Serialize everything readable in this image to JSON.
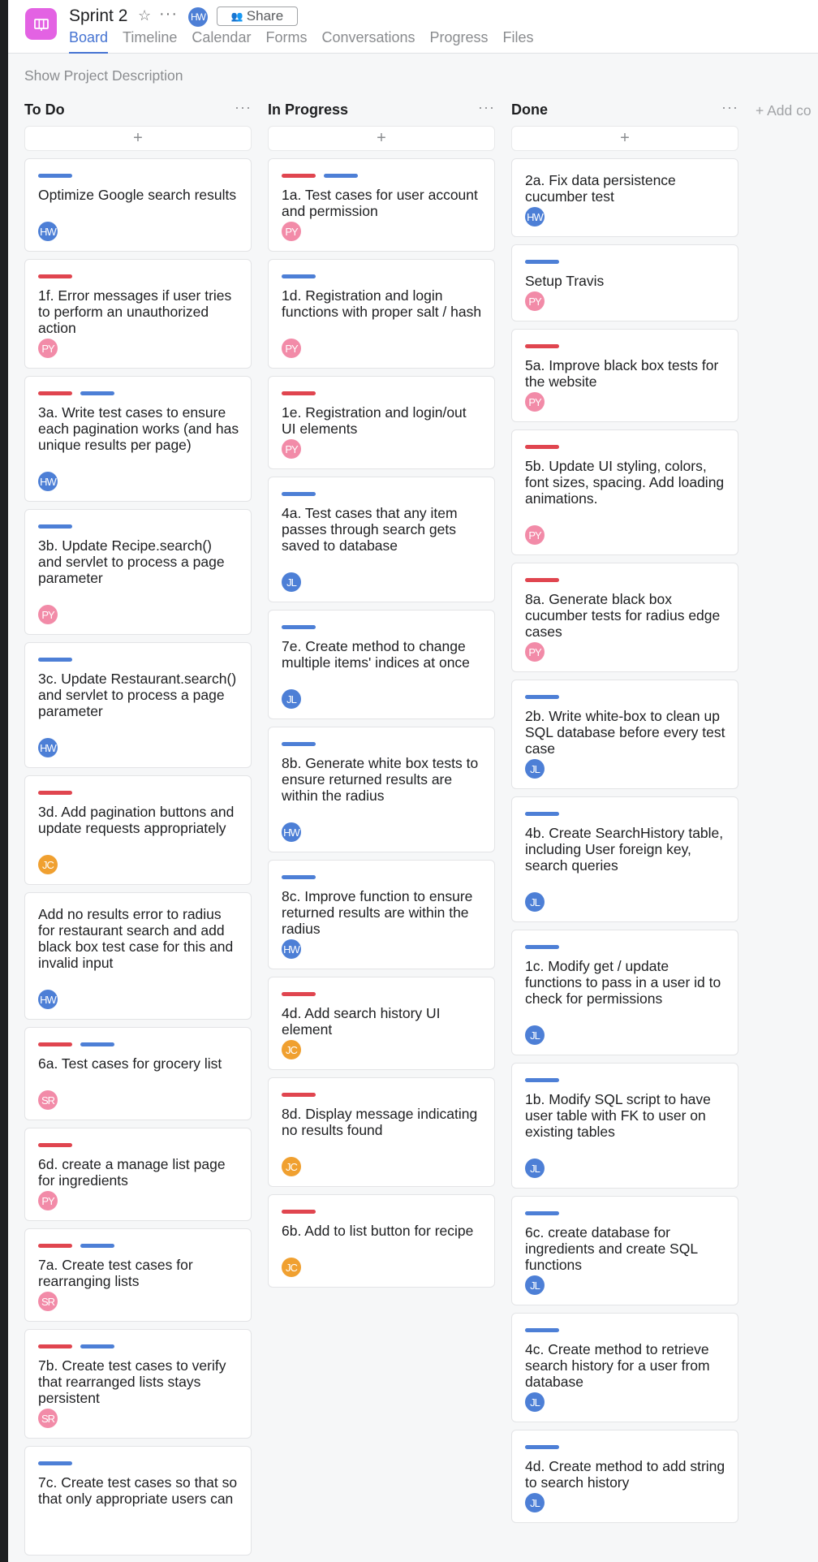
{
  "project": {
    "title": "Sprint 2",
    "header_avatar": "HW",
    "share_label": "Share",
    "icon": "board-icon"
  },
  "tabs": [
    "Board",
    "Timeline",
    "Calendar",
    "Forms",
    "Conversations",
    "Progress",
    "Files"
  ],
  "active_tab": "Board",
  "show_description_label": "Show Project Description",
  "add_column_label": "+ Add co",
  "add_task_label": "+",
  "colors": {
    "accent": "#4573d2",
    "tag_red": "#e0454f",
    "tag_blue": "#4d7fd6",
    "avatar_HW": "#4d7fd6",
    "avatar_JL": "#4d7fd6",
    "avatar_PY": "#f28ba8",
    "avatar_SR": "#f28ba8",
    "avatar_JC": "#f0a030",
    "project_icon": "#e362e3"
  },
  "columns": [
    {
      "title": "To Do",
      "cards": [
        {
          "title": "Optimize Google search results",
          "tags": [
            "blue"
          ],
          "assignee": "HW"
        },
        {
          "title": "1f. Error messages if user tries to perform an unauthorized action",
          "tags": [
            "red"
          ],
          "assignee": "PY"
        },
        {
          "title": "3a. Write test cases to ensure each pagination works (and has unique results per page)",
          "tags": [
            "red",
            "blue"
          ],
          "assignee": "HW"
        },
        {
          "title": "3b. Update Recipe.search() and servlet to process a page parameter",
          "tags": [
            "blue"
          ],
          "assignee": "PY"
        },
        {
          "title": "3c. Update Restaurant.search() and servlet to process a page parameter",
          "tags": [
            "blue"
          ],
          "assignee": "HW"
        },
        {
          "title": "3d. Add pagination buttons and update requests appropriately",
          "tags": [
            "red"
          ],
          "assignee": "JC"
        },
        {
          "title": "Add no results error to radius for restaurant search and add black box test case for this and invalid input",
          "tags": [],
          "assignee": "HW"
        },
        {
          "title": "6a. Test cases for grocery list",
          "tags": [
            "red",
            "blue"
          ],
          "assignee": "SR"
        },
        {
          "title": "6d. create a manage list page for ingredients",
          "tags": [
            "red"
          ],
          "assignee": "PY"
        },
        {
          "title": "7a. Create test cases for rearranging lists",
          "tags": [
            "red",
            "blue"
          ],
          "assignee": "SR"
        },
        {
          "title": "7b. Create test cases to verify that rearranged lists stays persistent",
          "tags": [
            "red",
            "blue"
          ],
          "assignee": "SR"
        },
        {
          "title": "7c. Create test cases so that so that only appropriate users can",
          "tags": [
            "blue"
          ],
          "assignee": ""
        }
      ]
    },
    {
      "title": "In Progress",
      "cards": [
        {
          "title": "1a. Test cases for user account and permission",
          "tags": [
            "red",
            "blue"
          ],
          "assignee": "PY"
        },
        {
          "title": "1d. Registration and login functions with proper salt / hash",
          "tags": [
            "blue"
          ],
          "assignee": "PY"
        },
        {
          "title": "1e. Registration and login/out UI elements",
          "tags": [
            "red"
          ],
          "assignee": "PY"
        },
        {
          "title": "4a. Test cases that any item passes through search gets saved to database",
          "tags": [
            "blue"
          ],
          "assignee": "JL"
        },
        {
          "title": "7e. Create method to change multiple items' indices at once",
          "tags": [
            "blue"
          ],
          "assignee": "JL"
        },
        {
          "title": "8b. Generate white box tests to ensure returned results are within the radius",
          "tags": [
            "blue"
          ],
          "assignee": "HW"
        },
        {
          "title": "8c. Improve function to ensure returned results are within the radius",
          "tags": [
            "blue"
          ],
          "assignee": "HW"
        },
        {
          "title": "4d. Add search history UI element",
          "tags": [
            "red"
          ],
          "assignee": "JC"
        },
        {
          "title": "8d. Display message indicating no results found",
          "tags": [
            "red"
          ],
          "assignee": "JC"
        },
        {
          "title": "6b. Add to list button for recipe",
          "tags": [
            "red"
          ],
          "assignee": "JC"
        }
      ]
    },
    {
      "title": "Done",
      "cards": [
        {
          "title": "2a. Fix data persistence cucumber test",
          "tags": [],
          "assignee": "HW"
        },
        {
          "title": "Setup Travis",
          "tags": [
            "blue"
          ],
          "assignee": "PY"
        },
        {
          "title": "5a. Improve black box tests for the website",
          "tags": [
            "red"
          ],
          "assignee": "PY"
        },
        {
          "title": "5b. Update UI styling, colors, font sizes, spacing. Add loading animations.",
          "tags": [
            "red"
          ],
          "assignee": "PY"
        },
        {
          "title": "8a. Generate black box cucumber tests for radius edge cases",
          "tags": [
            "red"
          ],
          "assignee": "PY"
        },
        {
          "title": "2b. Write white-box to clean up SQL database before every test case",
          "tags": [
            "blue"
          ],
          "assignee": "JL"
        },
        {
          "title": "4b. Create SearchHistory table, including User foreign key, search queries",
          "tags": [
            "blue"
          ],
          "assignee": "JL"
        },
        {
          "title": "1c. Modify get / update functions to pass in a user id to check for permissions",
          "tags": [
            "blue"
          ],
          "assignee": "JL"
        },
        {
          "title": "1b. Modify SQL script to have user table with FK to user on existing tables",
          "tags": [
            "blue"
          ],
          "assignee": "JL"
        },
        {
          "title": "6c. create database for ingredients and create SQL functions",
          "tags": [
            "blue"
          ],
          "assignee": "JL"
        },
        {
          "title": "4c. Create method to retrieve search history for a user from database",
          "tags": [
            "blue"
          ],
          "assignee": "JL"
        },
        {
          "title": "4d. Create method to add string to search history",
          "tags": [
            "blue"
          ],
          "assignee": "JL"
        }
      ]
    }
  ]
}
